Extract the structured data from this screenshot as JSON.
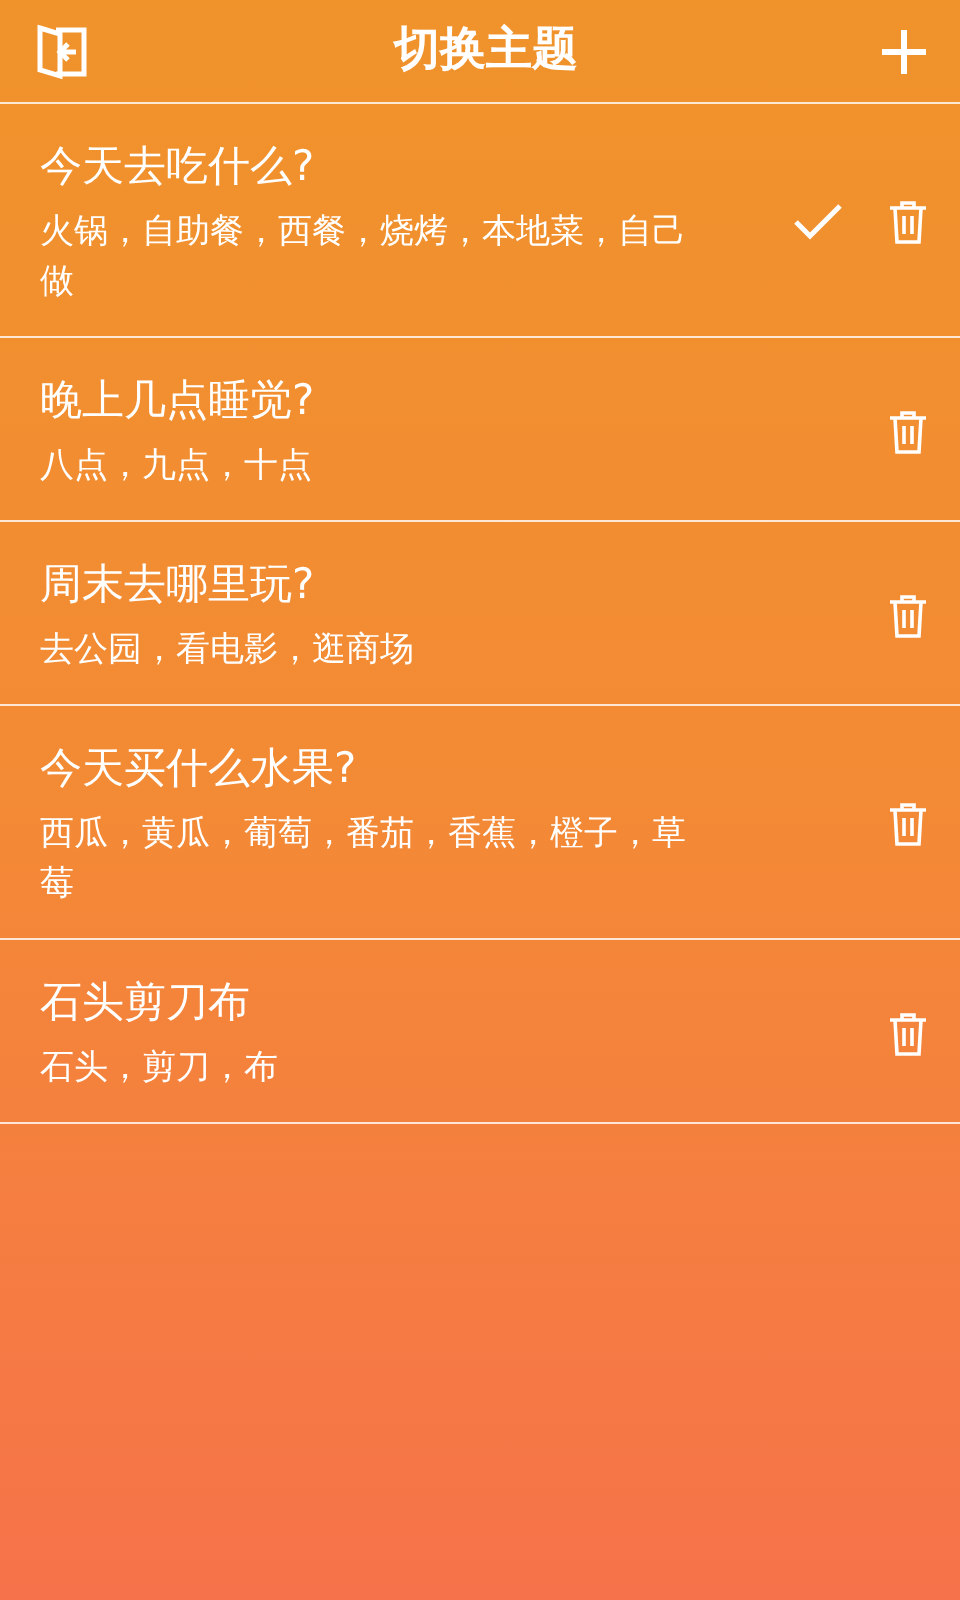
{
  "header": {
    "title": "切换主题"
  },
  "topics": [
    {
      "title": "今天去吃什么?",
      "options": "火锅，自助餐，西餐，烧烤，本地菜，自己做",
      "selected": true
    },
    {
      "title": "晚上几点睡觉?",
      "options": "八点，九点，十点",
      "selected": false
    },
    {
      "title": "周末去哪里玩?",
      "options": "去公园，看电影，逛商场",
      "selected": false
    },
    {
      "title": "今天买什么水果?",
      "options": "西瓜，黄瓜，葡萄，番茄，香蕉，橙子，草莓",
      "selected": false
    },
    {
      "title": "石头剪刀布",
      "options": "石头，剪刀，布",
      "selected": false
    }
  ]
}
